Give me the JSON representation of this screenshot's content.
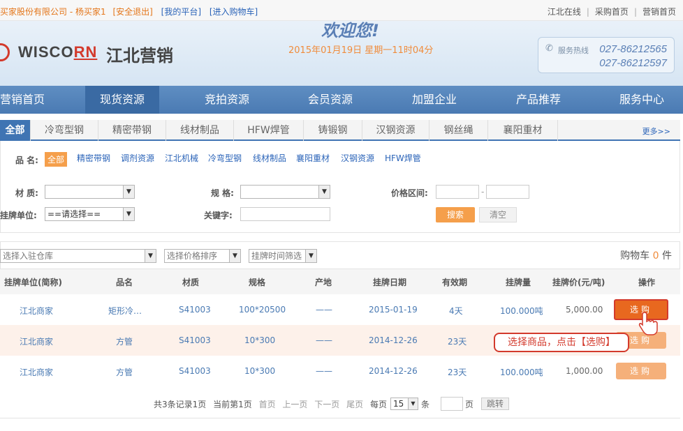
{
  "topbar": {
    "user": "买家股份有限公司 - 杨买家1",
    "logout": "[安全退出]",
    "my_platform": "[我的平台]",
    "cart_link": "[进入购物车]",
    "right_links": [
      "江北在线",
      "采购首页",
      "营销首页"
    ]
  },
  "banner": {
    "logo_en_a": "WISCO",
    "logo_en_b": "RN",
    "logo_cn": "江北营销",
    "welcome": "欢迎您!",
    "datetime": "2015年01月19日 星期一11时04分",
    "hotline_label": "服务热线",
    "hotline1": "027-86212565",
    "hotline2": "027-86212597"
  },
  "nav": [
    "营销首页",
    "现货资源",
    "竞拍资源",
    "会员资源",
    "加盟企业",
    "产品推荐",
    "服务中心"
  ],
  "subtabs": [
    "全部",
    "冷弯型钢",
    "精密带钢",
    "线材制品",
    "HFW焊管",
    "铸锻钢",
    "汉钢资源",
    "钢丝绳",
    "襄阳重材"
  ],
  "more": "更多>>",
  "filter": {
    "product_label": "品 名:",
    "products": [
      "全部",
      "精密带钢",
      "调剂资源",
      "江北机械",
      "冷弯型钢",
      "线材制品",
      "襄阳重材",
      "汉钢资源",
      "HFW焊管"
    ],
    "material_label": "材 质:",
    "spec_label": "规 格:",
    "price_label": "价格区间:",
    "price_dash": "-",
    "unit_label": "挂牌单位:",
    "unit_value": "==请选择==",
    "keyword_label": "关键字:",
    "search_btn": "搜索",
    "clear_btn": "清空"
  },
  "listbar": {
    "warehouse": "选择入驻仓库",
    "price_sort": "选择价格排序",
    "time_filter": "挂牌时间筛选",
    "cart_text": "购物车",
    "cart_count": "0",
    "cart_unit": "件"
  },
  "table": {
    "headers": [
      "挂牌单位(简称)",
      "品名",
      "材质",
      "规格",
      "产地",
      "挂牌日期",
      "有效期",
      "挂牌量",
      "挂牌价(元/吨)",
      "操作"
    ],
    "rows": [
      {
        "unit": "江北商家",
        "name": "矩形冷…",
        "material": "S41003",
        "spec": "100*20500",
        "origin": "——",
        "date": "2015-01-19",
        "valid": "4天",
        "qty": "100.000吨",
        "price": "5,000.00",
        "op": "选购"
      },
      {
        "unit": "江北商家",
        "name": "方管",
        "material": "S41003",
        "spec": "10*300",
        "origin": "——",
        "date": "2014-12-26",
        "valid": "23天",
        "qty": "",
        "price": "",
        "op": "选购"
      },
      {
        "unit": "江北商家",
        "name": "方管",
        "material": "S41003",
        "spec": "10*300",
        "origin": "——",
        "date": "2014-12-26",
        "valid": "23天",
        "qty": "100.000吨",
        "price": "1,000.00",
        "op": "选购"
      }
    ]
  },
  "callout": "选择商品，点击【选购】",
  "pager": {
    "total": "共3条记录1页",
    "current": "当前第1页",
    "first": "首页",
    "prev": "上一页",
    "next": "下一页",
    "last": "尾页",
    "per_page_label": "每页",
    "per_page": "15",
    "tiao": "条",
    "page_label": "页",
    "jump": "跳转"
  },
  "colors": {
    "accent": "#4a7ab3",
    "orange": "#f59f4b",
    "red": "#d33a2c"
  }
}
